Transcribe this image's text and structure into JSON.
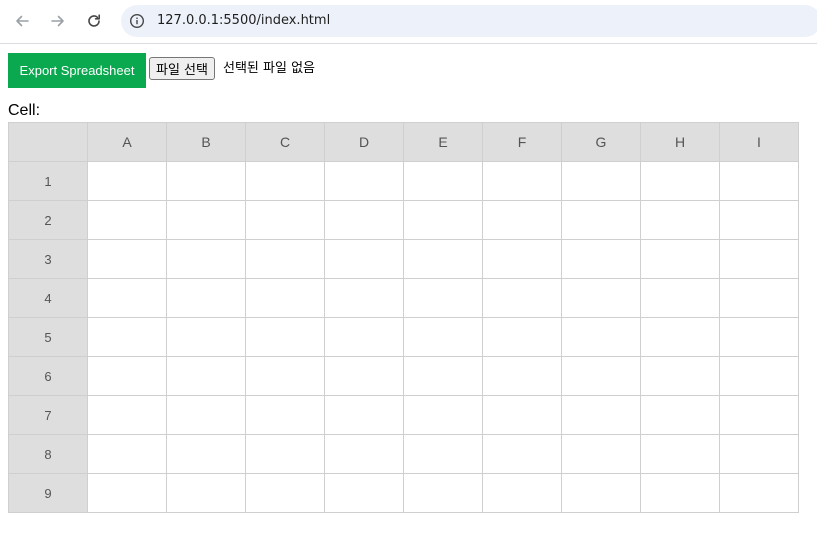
{
  "browser": {
    "back_icon": "arrow-left-icon",
    "forward_icon": "arrow-right-icon",
    "reload_icon": "reload-icon",
    "info_icon": "info-icon",
    "url": "127.0.0.1:5500/index.html"
  },
  "controls": {
    "export_label": "Export Spreadsheet",
    "export_color": "#0aa84f",
    "file_button_label": "파일 선택",
    "file_status": "선택된 파일 없음",
    "cell_label": "Cell:"
  },
  "grid": {
    "columns": [
      "A",
      "B",
      "C",
      "D",
      "E",
      "F",
      "G",
      "H",
      "I"
    ],
    "rows": [
      "1",
      "2",
      "3",
      "4",
      "5",
      "6",
      "7",
      "8",
      "9"
    ],
    "header_color": "#dedede"
  }
}
